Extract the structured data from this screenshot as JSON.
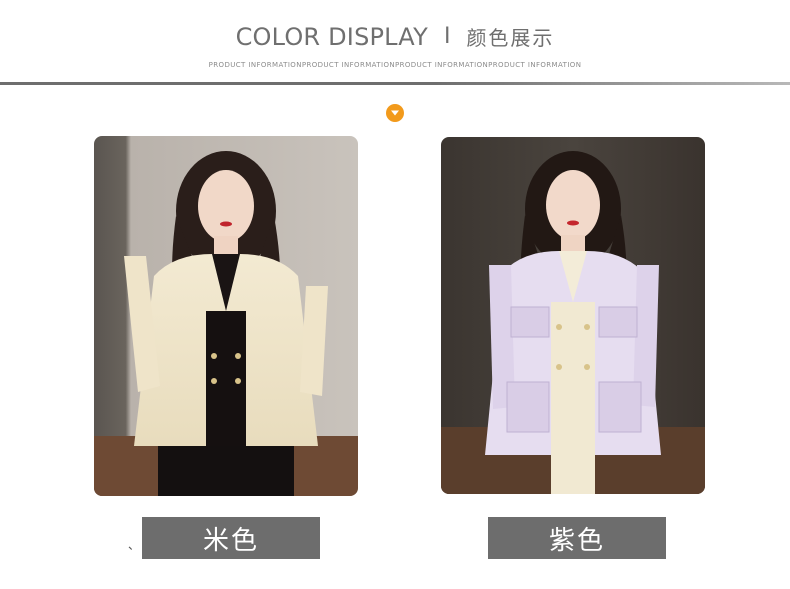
{
  "header": {
    "title_en": "COLOR DISPLAY",
    "separator": "I",
    "title_cn": "颜色展示",
    "subtitle": "PRODUCT INFORMATIONPRODUCT INFORMATIONPRODUCT INFORMATIONPRODUCT INFORMATION"
  },
  "accent_color": "#f29a1b",
  "label_bg_color": "#6d6d6d",
  "icons": {
    "down": "chevron-down-icon"
  },
  "products": [
    {
      "color_name": "米色",
      "image": "model wearing beige tweed jacket"
    },
    {
      "color_name": "紫色",
      "image": "model wearing lilac tweed jacket"
    }
  ],
  "stray_mark": "、"
}
